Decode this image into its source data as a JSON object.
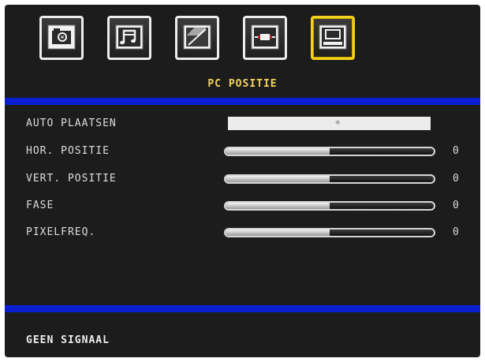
{
  "menu": {
    "icons": [
      {
        "name": "picture-icon",
        "active": false
      },
      {
        "name": "sound-icon",
        "active": false
      },
      {
        "name": "settings-icon",
        "active": false
      },
      {
        "name": "source-icon",
        "active": false
      },
      {
        "name": "pc-icon",
        "active": true
      }
    ],
    "title": "PC POSITIE"
  },
  "rows": [
    {
      "label": "AUTO PLAATSEN",
      "type": "action"
    },
    {
      "label": "HOR. POSITIE",
      "type": "slider",
      "value": "0",
      "level": 0.5
    },
    {
      "label": "VERT. POSITIE",
      "type": "slider",
      "value": "0",
      "level": 0.5
    },
    {
      "label": "FASE",
      "type": "slider",
      "value": "0",
      "level": 0.5
    },
    {
      "label": "PIXELFREQ.",
      "type": "slider",
      "value": "0",
      "level": 0.5
    }
  ],
  "status": "GEEN SIGNAAL",
  "colors": {
    "background": "#1c1c1c",
    "accent_blue": "#0b1fd2",
    "title_yellow": "#f2d45a",
    "active_border": "#f2d21a"
  }
}
